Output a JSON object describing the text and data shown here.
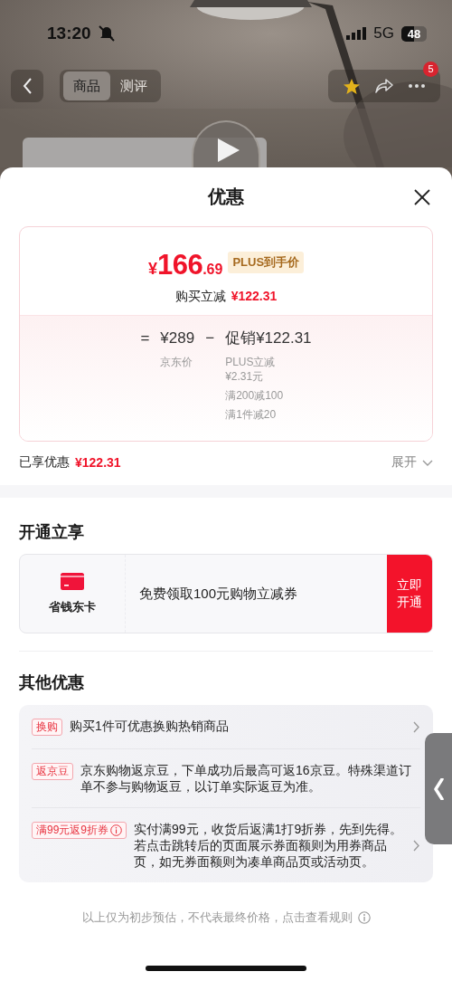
{
  "status_bar": {
    "time": "13:20",
    "network": "5G",
    "battery": "48"
  },
  "nav": {
    "tabs": [
      {
        "label": "商品",
        "selected": true
      },
      {
        "label": "测评",
        "selected": false
      }
    ],
    "more_badge": "5"
  },
  "sheet": {
    "title": "优惠",
    "price_card": {
      "currency": "¥",
      "price_integer": "166",
      "price_decimal": ".69",
      "price_tag": "PLUS到手价",
      "saving_label": "购买立减",
      "saving_amount": "¥122.31",
      "formula": {
        "equals": "=",
        "base_price": "¥289",
        "base_label": "京东价",
        "minus": "−",
        "promo": "促销¥122.31",
        "promo_details": [
          "PLUS立减¥2.31元",
          "满200减100",
          "满1件减20"
        ]
      }
    },
    "summary": {
      "label": "已享优惠",
      "amount": "¥122.31",
      "toggle": "展开",
      "expanded": false
    },
    "membership": {
      "heading": "开通立享",
      "card_name": "省钱东卡",
      "offer": "免费领取100元购物立减券",
      "action": "立即开通"
    },
    "other": {
      "heading": "其他优惠",
      "items": [
        {
          "tag": "换购",
          "tag_info": false,
          "text": "购买1件可优惠换购热销商品",
          "has_arrow": true
        },
        {
          "tag": "返京豆",
          "tag_info": false,
          "text": "京东购物返京豆，下单成功后最高可返16京豆。特殊渠道订单不参与购物返豆，以订单实际返豆为准。",
          "has_arrow": false
        },
        {
          "tag": "满99元返9折券",
          "tag_info": true,
          "text": "实付满99元，收货后返满1打9折券，先到先得。若点击跳转后的页面展示券面额则为用券商品页，如无券面额则为凑单商品页或活动页。",
          "has_arrow": true
        }
      ]
    },
    "footer": "以上仅为初步预估，不代表最终价格，点击查看规则"
  }
}
